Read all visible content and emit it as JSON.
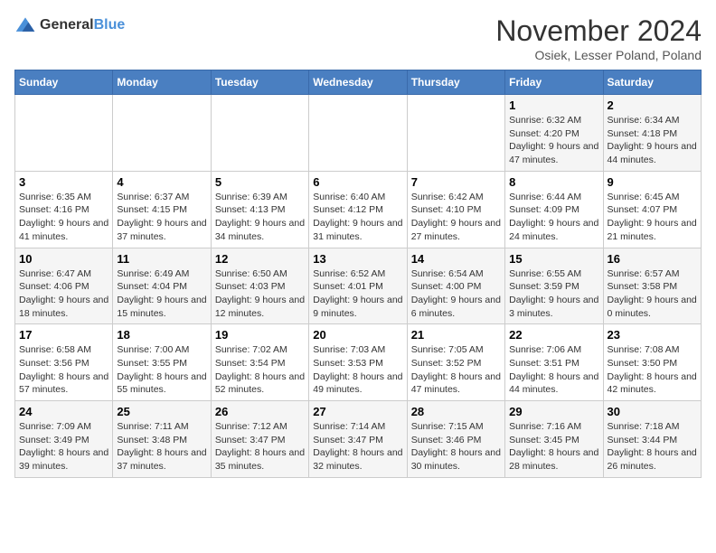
{
  "logo": {
    "general": "General",
    "blue": "Blue"
  },
  "title": "November 2024",
  "location": "Osiek, Lesser Poland, Poland",
  "days_header": [
    "Sunday",
    "Monday",
    "Tuesday",
    "Wednesday",
    "Thursday",
    "Friday",
    "Saturday"
  ],
  "weeks": [
    [
      {
        "num": "",
        "info": ""
      },
      {
        "num": "",
        "info": ""
      },
      {
        "num": "",
        "info": ""
      },
      {
        "num": "",
        "info": ""
      },
      {
        "num": "",
        "info": ""
      },
      {
        "num": "1",
        "info": "Sunrise: 6:32 AM\nSunset: 4:20 PM\nDaylight: 9 hours and 47 minutes."
      },
      {
        "num": "2",
        "info": "Sunrise: 6:34 AM\nSunset: 4:18 PM\nDaylight: 9 hours and 44 minutes."
      }
    ],
    [
      {
        "num": "3",
        "info": "Sunrise: 6:35 AM\nSunset: 4:16 PM\nDaylight: 9 hours and 41 minutes."
      },
      {
        "num": "4",
        "info": "Sunrise: 6:37 AM\nSunset: 4:15 PM\nDaylight: 9 hours and 37 minutes."
      },
      {
        "num": "5",
        "info": "Sunrise: 6:39 AM\nSunset: 4:13 PM\nDaylight: 9 hours and 34 minutes."
      },
      {
        "num": "6",
        "info": "Sunrise: 6:40 AM\nSunset: 4:12 PM\nDaylight: 9 hours and 31 minutes."
      },
      {
        "num": "7",
        "info": "Sunrise: 6:42 AM\nSunset: 4:10 PM\nDaylight: 9 hours and 27 minutes."
      },
      {
        "num": "8",
        "info": "Sunrise: 6:44 AM\nSunset: 4:09 PM\nDaylight: 9 hours and 24 minutes."
      },
      {
        "num": "9",
        "info": "Sunrise: 6:45 AM\nSunset: 4:07 PM\nDaylight: 9 hours and 21 minutes."
      }
    ],
    [
      {
        "num": "10",
        "info": "Sunrise: 6:47 AM\nSunset: 4:06 PM\nDaylight: 9 hours and 18 minutes."
      },
      {
        "num": "11",
        "info": "Sunrise: 6:49 AM\nSunset: 4:04 PM\nDaylight: 9 hours and 15 minutes."
      },
      {
        "num": "12",
        "info": "Sunrise: 6:50 AM\nSunset: 4:03 PM\nDaylight: 9 hours and 12 minutes."
      },
      {
        "num": "13",
        "info": "Sunrise: 6:52 AM\nSunset: 4:01 PM\nDaylight: 9 hours and 9 minutes."
      },
      {
        "num": "14",
        "info": "Sunrise: 6:54 AM\nSunset: 4:00 PM\nDaylight: 9 hours and 6 minutes."
      },
      {
        "num": "15",
        "info": "Sunrise: 6:55 AM\nSunset: 3:59 PM\nDaylight: 9 hours and 3 minutes."
      },
      {
        "num": "16",
        "info": "Sunrise: 6:57 AM\nSunset: 3:58 PM\nDaylight: 9 hours and 0 minutes."
      }
    ],
    [
      {
        "num": "17",
        "info": "Sunrise: 6:58 AM\nSunset: 3:56 PM\nDaylight: 8 hours and 57 minutes."
      },
      {
        "num": "18",
        "info": "Sunrise: 7:00 AM\nSunset: 3:55 PM\nDaylight: 8 hours and 55 minutes."
      },
      {
        "num": "19",
        "info": "Sunrise: 7:02 AM\nSunset: 3:54 PM\nDaylight: 8 hours and 52 minutes."
      },
      {
        "num": "20",
        "info": "Sunrise: 7:03 AM\nSunset: 3:53 PM\nDaylight: 8 hours and 49 minutes."
      },
      {
        "num": "21",
        "info": "Sunrise: 7:05 AM\nSunset: 3:52 PM\nDaylight: 8 hours and 47 minutes."
      },
      {
        "num": "22",
        "info": "Sunrise: 7:06 AM\nSunset: 3:51 PM\nDaylight: 8 hours and 44 minutes."
      },
      {
        "num": "23",
        "info": "Sunrise: 7:08 AM\nSunset: 3:50 PM\nDaylight: 8 hours and 42 minutes."
      }
    ],
    [
      {
        "num": "24",
        "info": "Sunrise: 7:09 AM\nSunset: 3:49 PM\nDaylight: 8 hours and 39 minutes."
      },
      {
        "num": "25",
        "info": "Sunrise: 7:11 AM\nSunset: 3:48 PM\nDaylight: 8 hours and 37 minutes."
      },
      {
        "num": "26",
        "info": "Sunrise: 7:12 AM\nSunset: 3:47 PM\nDaylight: 8 hours and 35 minutes."
      },
      {
        "num": "27",
        "info": "Sunrise: 7:14 AM\nSunset: 3:47 PM\nDaylight: 8 hours and 32 minutes."
      },
      {
        "num": "28",
        "info": "Sunrise: 7:15 AM\nSunset: 3:46 PM\nDaylight: 8 hours and 30 minutes."
      },
      {
        "num": "29",
        "info": "Sunrise: 7:16 AM\nSunset: 3:45 PM\nDaylight: 8 hours and 28 minutes."
      },
      {
        "num": "30",
        "info": "Sunrise: 7:18 AM\nSunset: 3:44 PM\nDaylight: 8 hours and 26 minutes."
      }
    ]
  ]
}
